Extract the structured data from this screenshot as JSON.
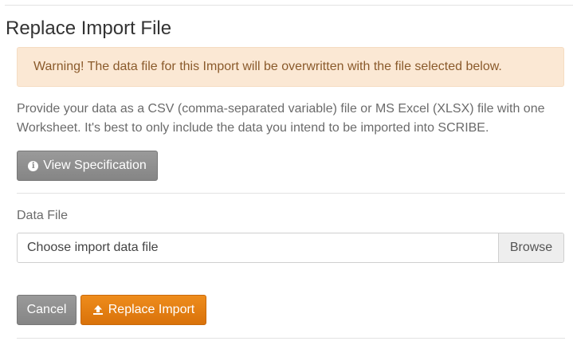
{
  "page": {
    "title": "Replace Import File"
  },
  "warning": {
    "text": "Warning! The data file for this Import will be overwritten with the file selected below."
  },
  "description": {
    "text": "Provide your data as a CSV (comma-separated variable) file or MS Excel (XLSX) file with one Worksheet. It's best to only include the data you intend to be imported into SCRIBE."
  },
  "spec_button": {
    "icon": "info-circle-icon",
    "label": "View Specification"
  },
  "data_file": {
    "label": "Data File",
    "placeholder": "Choose import data file",
    "browse_label": "Browse"
  },
  "actions": {
    "cancel_label": "Cancel",
    "replace_label": "Replace Import",
    "replace_icon": "upload-icon",
    "replace_color": "#e67e0f"
  }
}
